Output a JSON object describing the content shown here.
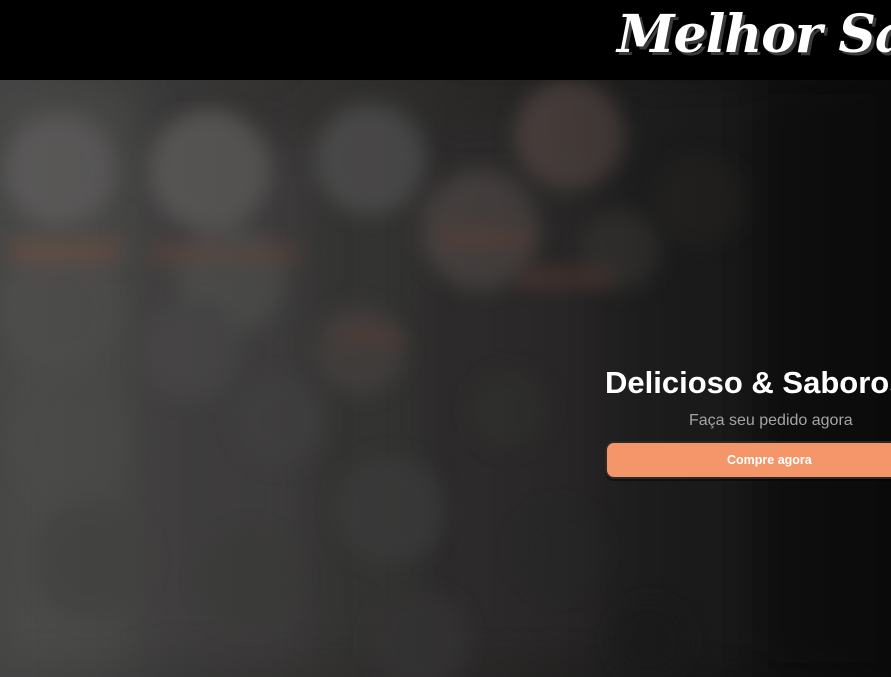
{
  "header": {
    "brand": "Melhor Sabor"
  },
  "hero": {
    "title": "Delicioso & Saboroso",
    "subtitle": "Faça seu pedido agora",
    "cta_label": "Compre agora"
  },
  "colors": {
    "header_bg": "#000000",
    "brand_text": "#ffffff",
    "cta_bg": "#f4966a",
    "cta_text": "#ffffff",
    "subtitle_text": "#a4a4a4"
  }
}
